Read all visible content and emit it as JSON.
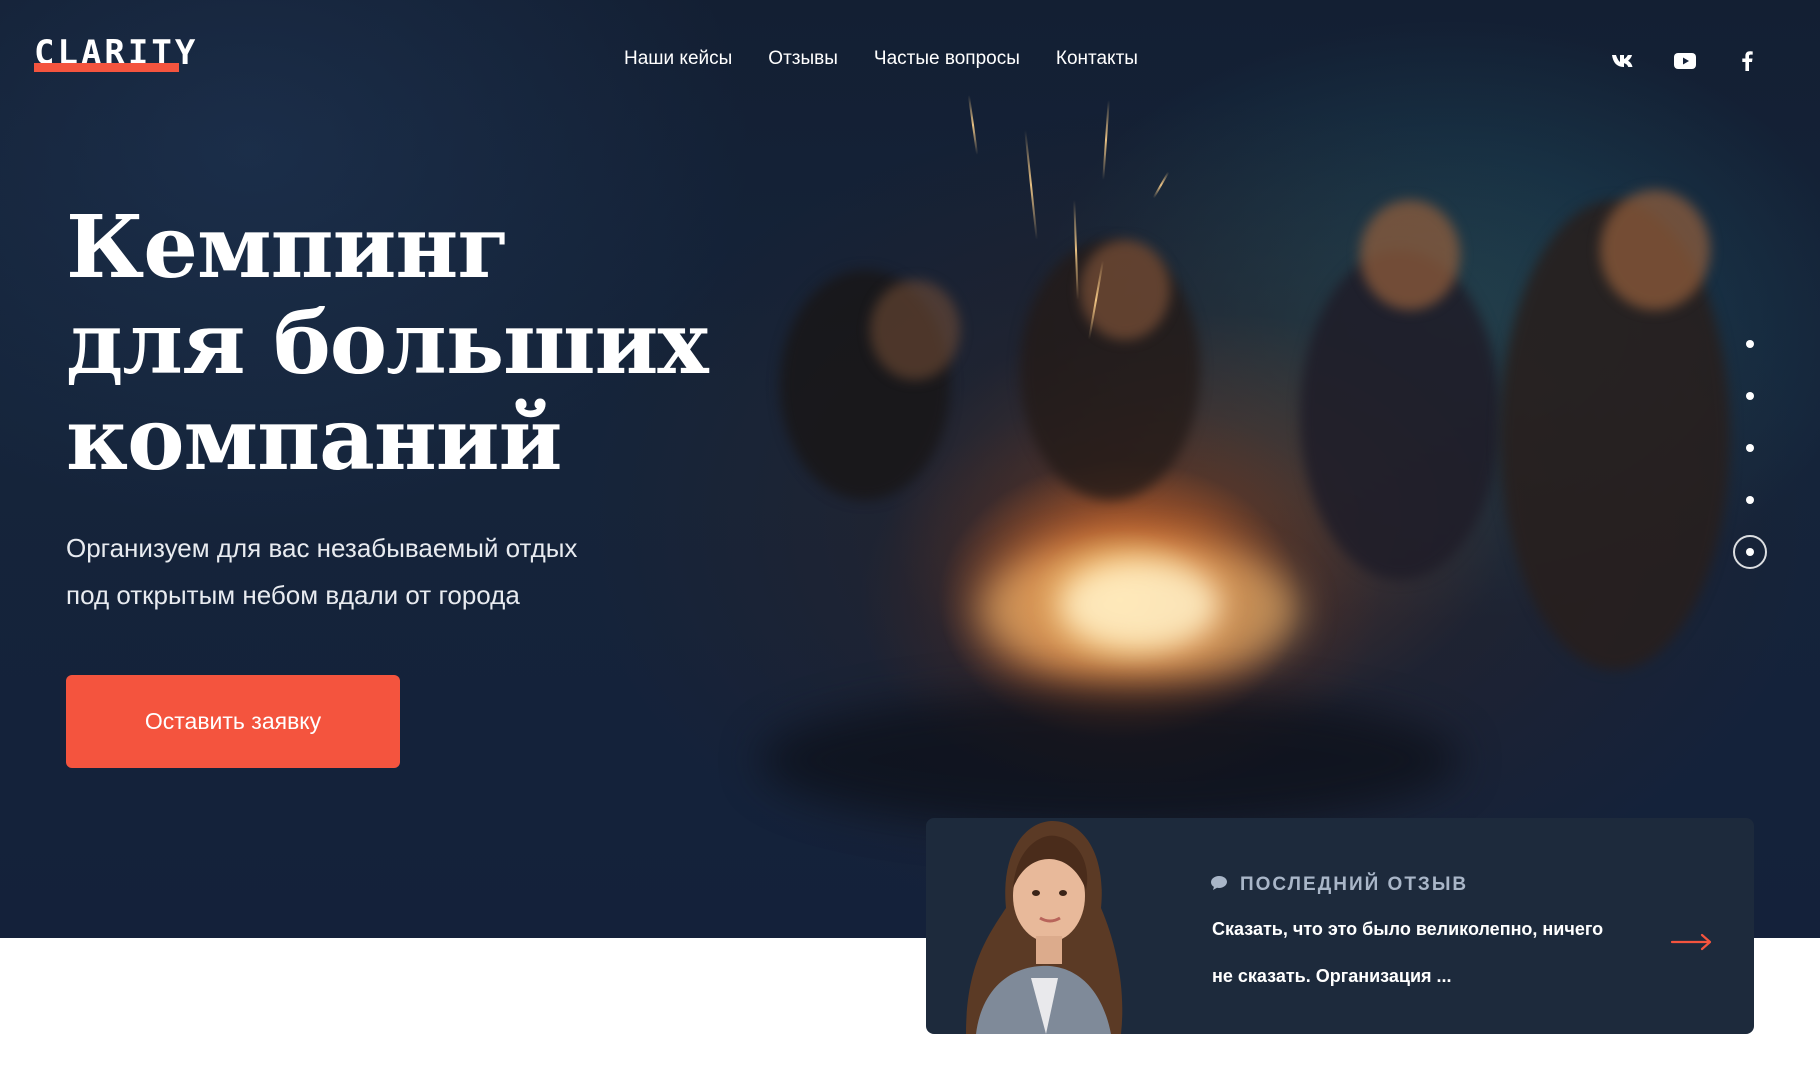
{
  "header": {
    "logo": "CLARITY",
    "nav": [
      {
        "label": "Наши кейсы"
      },
      {
        "label": "Отзывы"
      },
      {
        "label": "Частые вопросы"
      },
      {
        "label": "Контакты"
      }
    ],
    "socials": [
      "vk-icon",
      "youtube-icon",
      "facebook-icon"
    ]
  },
  "hero": {
    "title_lines": [
      "Кемпинг",
      "для больших",
      "компаний"
    ],
    "subtitle_lines": [
      "Организуем для вас незабываемый отдых",
      "под открытым небом вдали от города"
    ],
    "cta_label": "Оставить заявку"
  },
  "slider": {
    "total": 5,
    "active": 5
  },
  "review": {
    "label": "ПОСЛЕДНИЙ ОТЗЫВ",
    "text_lines": [
      "Сказать, что это было великолепно, ничего",
      "не сказать. Организация ..."
    ]
  },
  "colors": {
    "accent": "#f4543e",
    "hero_bg": "#14213a",
    "card_bg": "#1d2a3c",
    "label": "#a9b6c8"
  }
}
